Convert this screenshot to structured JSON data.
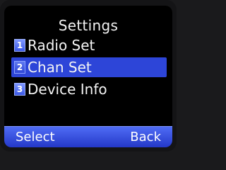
{
  "header": {
    "title": "Settings"
  },
  "menu": {
    "items": [
      {
        "number": "1",
        "label": "Radio Set",
        "selected": false
      },
      {
        "number": "2",
        "label": "Chan Set",
        "selected": true
      },
      {
        "number": "3",
        "label": "Device Info",
        "selected": false
      }
    ]
  },
  "softkeys": {
    "left_label": "Select",
    "right_label": "Back"
  },
  "colors": {
    "highlight": "#2d45d8",
    "softkey_bar": "#3550e0",
    "background": "#000000",
    "text": "#f4f4f4"
  }
}
